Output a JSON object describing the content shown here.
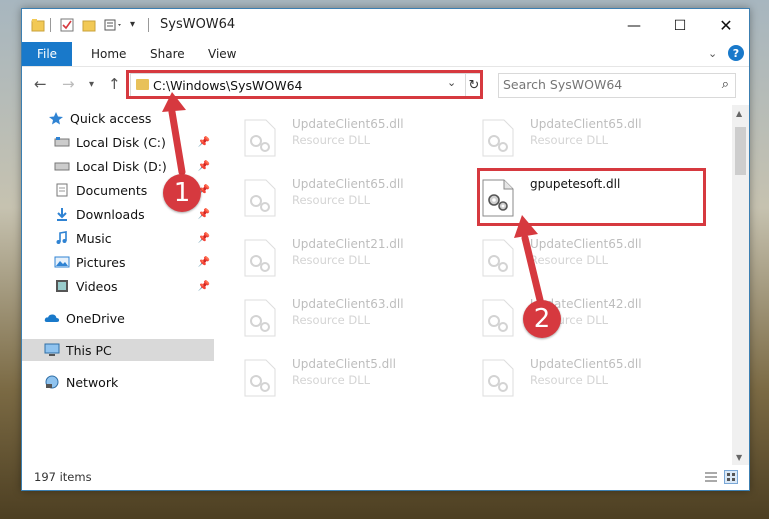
{
  "window": {
    "title": "SysWOW64"
  },
  "ribbon": {
    "tabs": [
      "File",
      "Home",
      "Share",
      "View"
    ]
  },
  "address": {
    "path": "C:\\Windows\\SysWOW64"
  },
  "search": {
    "placeholder": "Search SysWOW64"
  },
  "sidebar": {
    "items": [
      {
        "label": "Quick access",
        "icon": "star-icon"
      },
      {
        "label": "Local Disk (C:)",
        "icon": "drive-icon",
        "pinned": true
      },
      {
        "label": "Local Disk (D:)",
        "icon": "drive-icon",
        "pinned": true
      },
      {
        "label": "Documents",
        "icon": "documents-icon",
        "pinned": true
      },
      {
        "label": "Downloads",
        "icon": "downloads-icon",
        "pinned": true
      },
      {
        "label": "Music",
        "icon": "music-icon",
        "pinned": true
      },
      {
        "label": "Pictures",
        "icon": "pictures-icon",
        "pinned": true
      },
      {
        "label": "Videos",
        "icon": "videos-icon",
        "pinned": true
      },
      {
        "label": "OneDrive",
        "icon": "onedrive-icon"
      },
      {
        "label": "This PC",
        "icon": "this-pc-icon",
        "selected": true
      },
      {
        "label": "Network",
        "icon": "network-icon"
      }
    ]
  },
  "files": [
    {
      "name": "UpdateClient65.dll",
      "type": "Resource DLL"
    },
    {
      "name": "UpdateClient65.dll",
      "type": "Resource DLL"
    },
    {
      "name": "UpdateClient65.dll",
      "type": "Resource DLL"
    },
    {
      "name": "gpupetesoft.dll",
      "type": "",
      "featured": true
    },
    {
      "name": "UpdateClient21.dll",
      "type": "Resource DLL"
    },
    {
      "name": "UpdateClient65.dll",
      "type": "Resource DLL"
    },
    {
      "name": "UpdateClient63.dll",
      "type": "Resource DLL"
    },
    {
      "name": "UpdateClient42.dll",
      "type": "Resource DLL"
    },
    {
      "name": "UpdateClient5.dll",
      "type": "Resource DLL"
    },
    {
      "name": "UpdateClient65.dll",
      "type": "Resource DLL"
    }
  ],
  "status": {
    "item_count": "197 items"
  },
  "callouts": {
    "one": "1",
    "two": "2"
  },
  "colors": {
    "accent": "#1979ca",
    "highlight": "#d6393f"
  }
}
